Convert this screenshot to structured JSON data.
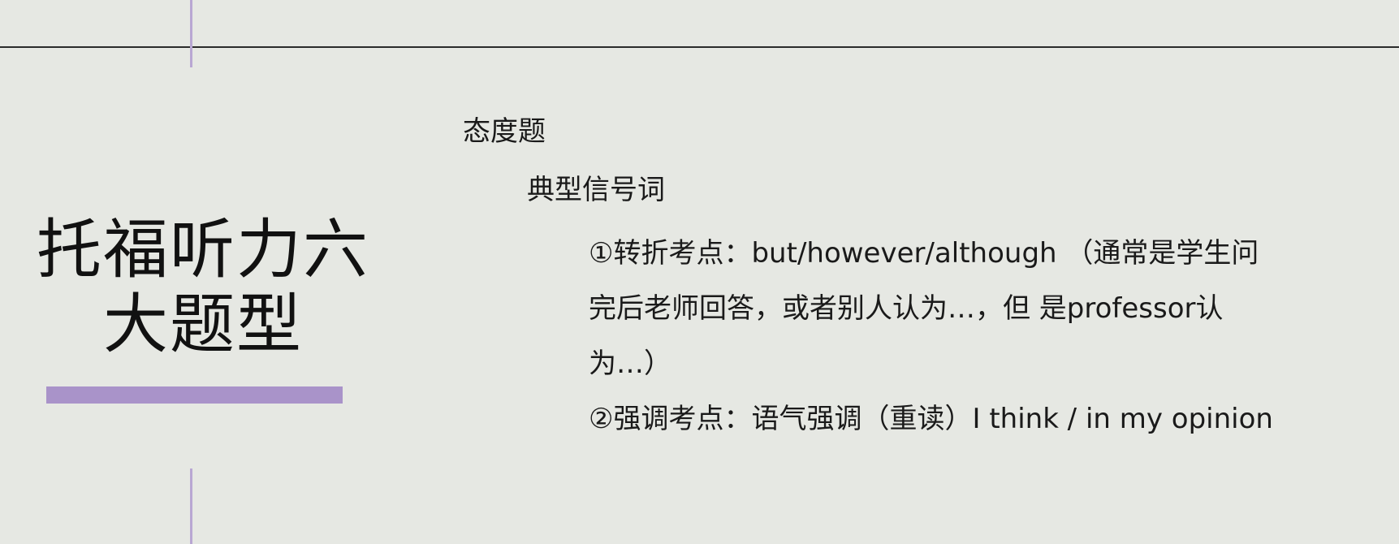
{
  "slide": {
    "title_line1": "托福听力六",
    "title_line2": "大题型",
    "heading": "态度题",
    "subheading": "典型信号词",
    "items": [
      {
        "text": "①转折考点：but/however/although （通常是学生问"
      },
      {
        "text": "完后老师回答，或者别人认为…，但 是professor认"
      },
      {
        "text": "为…）"
      },
      {
        "text": "②强调考点：语气强调（重读）I think / in my opinion"
      }
    ]
  },
  "colors": {
    "background": "#e6e8e3",
    "accent": "#a993c9",
    "rule": "#2b2b2b"
  }
}
